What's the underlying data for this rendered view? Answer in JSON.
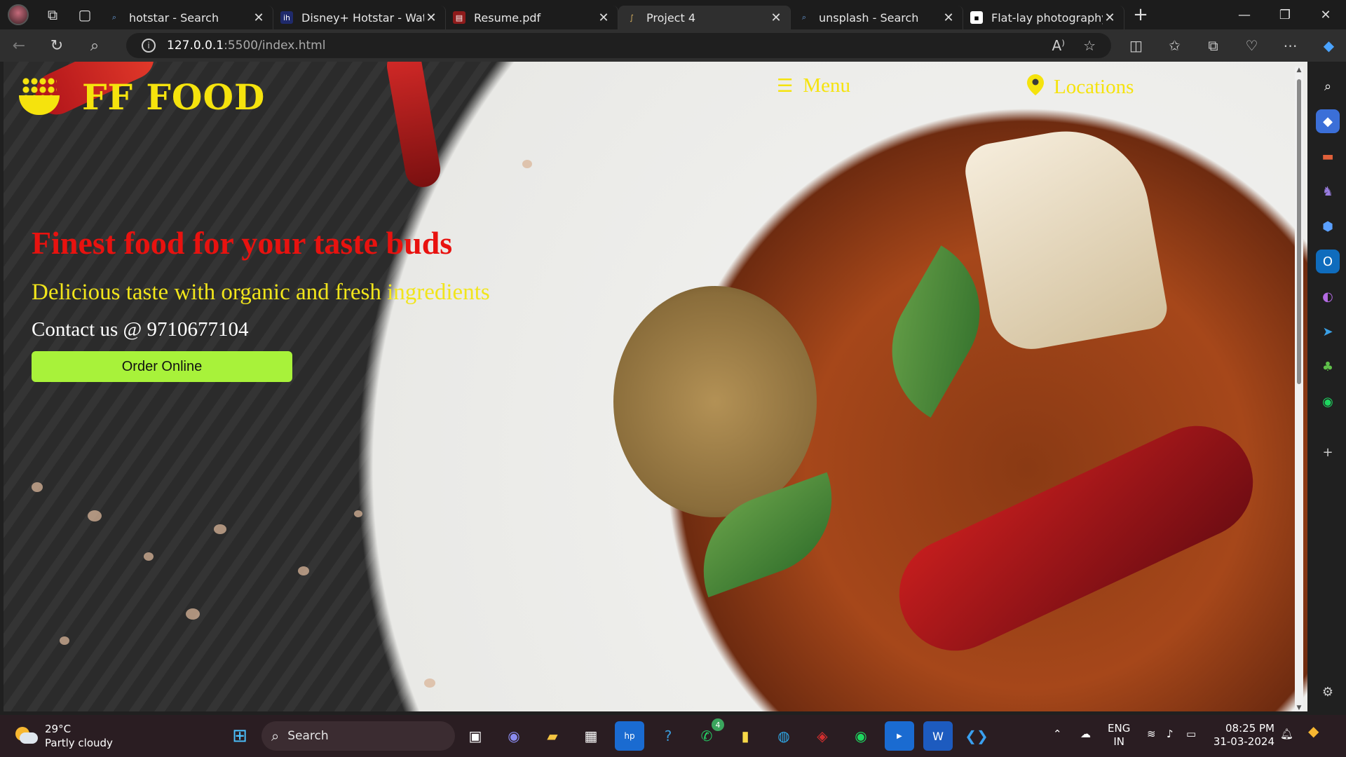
{
  "browser": {
    "tabs": [
      {
        "title": "hotstar - Search",
        "fav": "search-icon",
        "color": "#3a6ea5"
      },
      {
        "title": "Disney+ Hotstar - Watch",
        "fav": "hotstar-icon",
        "color": "#1f2a6b"
      },
      {
        "title": "Resume.pdf",
        "fav": "pdf-icon",
        "color": "#8e1b1b"
      },
      {
        "title": "Project 4",
        "fav": "vscode-live-icon",
        "color": "#c8a050"
      },
      {
        "title": "unsplash - Search",
        "fav": "search-icon",
        "color": "#3a6ea5"
      },
      {
        "title": "Flat-lay photography of v",
        "fav": "unsplash-icon",
        "color": "#000000"
      }
    ],
    "url_host": "127.0.0.1",
    "url_path": ":5500/index.html"
  },
  "site": {
    "brand": "FF FOOD",
    "nav_menu": "Menu",
    "nav_locations": "Locations",
    "headline": "Finest food for your taste buds",
    "subheadline": "Delicious taste with organic and fresh ingredients",
    "contact": "Contact us @ 9710677104",
    "order_button": "Order Online",
    "colors": {
      "brand": "#f5e30d",
      "headline": "#e8120f",
      "button": "#a8f23a"
    }
  },
  "taskbar": {
    "weather_temp": "29°C",
    "weather_desc": "Partly cloudy",
    "search_label": "Search",
    "whatsapp_badge": "4",
    "lang_top": "ENG",
    "lang_bottom": "IN",
    "time": "08:25 PM",
    "date": "31-03-2024"
  }
}
